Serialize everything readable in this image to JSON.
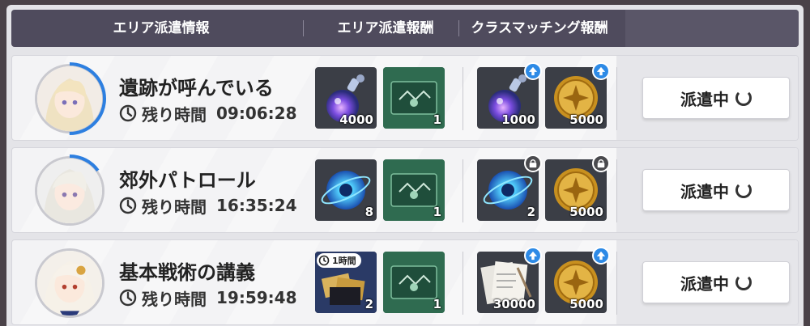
{
  "header": {
    "col1": "エリア派遣情報",
    "col2": "エリア派遣報酬",
    "col3": "クラスマッチング報酬"
  },
  "rows": [
    {
      "title": "遺跡が呼んでいる",
      "remaining_label": "残り時間",
      "remaining_time": "09:06:28",
      "progress": 0.5,
      "area_rewards": [
        {
          "icon": "potion-icon",
          "qty": "4000"
        },
        {
          "icon": "ticket-icon",
          "qty": "1"
        }
      ],
      "class_rewards": [
        {
          "icon": "potion-icon",
          "qty": "1000",
          "badge": "up"
        },
        {
          "icon": "gold-coin-icon",
          "qty": "5000",
          "badge": "up"
        }
      ],
      "button": "派遣中"
    },
    {
      "title": "郊外パトロール",
      "remaining_label": "残り時間",
      "remaining_time": "16:35:24",
      "progress": 0.15,
      "area_rewards": [
        {
          "icon": "blue-orb-icon",
          "qty": "8"
        },
        {
          "icon": "ticket-icon",
          "qty": "1"
        }
      ],
      "class_rewards": [
        {
          "icon": "blue-orb-icon",
          "qty": "2",
          "badge": "lock"
        },
        {
          "icon": "gold-coin-icon",
          "qty": "5000",
          "badge": "lock"
        }
      ],
      "button": "派遣中"
    },
    {
      "title": "基本戦術の講義",
      "remaining_label": "残り時間",
      "remaining_time": "19:59:48",
      "progress": 0.0,
      "area_rewards": [
        {
          "icon": "ticket-bundle-icon",
          "qty": "2",
          "tag": "1時間"
        },
        {
          "icon": "ticket-icon",
          "qty": "1"
        }
      ],
      "class_rewards": [
        {
          "icon": "documents-icon",
          "qty": "30000",
          "badge": "up"
        },
        {
          "icon": "gold-coin-icon",
          "qty": "5000",
          "badge": "up"
        }
      ],
      "button": "派遣中"
    }
  ],
  "colors": {
    "header_bg": "#4f4b5d",
    "progress_blue": "#2d7fe0",
    "badge_up": "#2d8ae6"
  }
}
